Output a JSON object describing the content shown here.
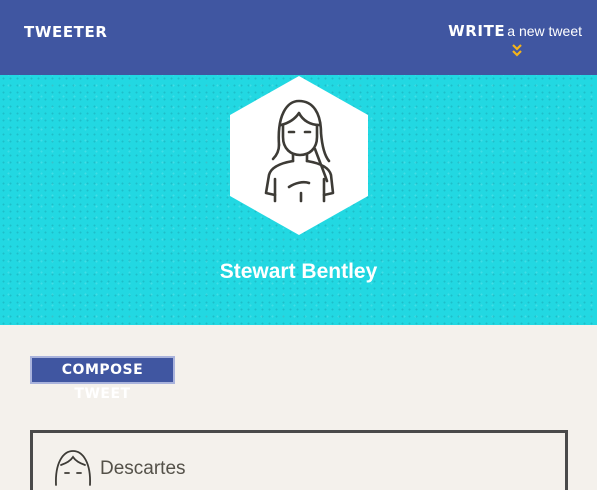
{
  "nav": {
    "brand": "TWEETER",
    "write_strong": "WRITE",
    "write_rest": "a new tweet"
  },
  "profile": {
    "name": "Stewart Bentley"
  },
  "compose": {
    "label": "COMPOSE TWEET"
  },
  "tweets": [
    {
      "author": "Descartes"
    }
  ],
  "colors": {
    "nav_bg": "#4056a1",
    "hero_bg": "#22d8e2",
    "page_bg": "#f4f1ec",
    "chevron": "#f4b41a"
  },
  "icons": {
    "write_arrow": "double-chevron-down-icon",
    "profile_avatar": "woman-avatar-icon"
  }
}
